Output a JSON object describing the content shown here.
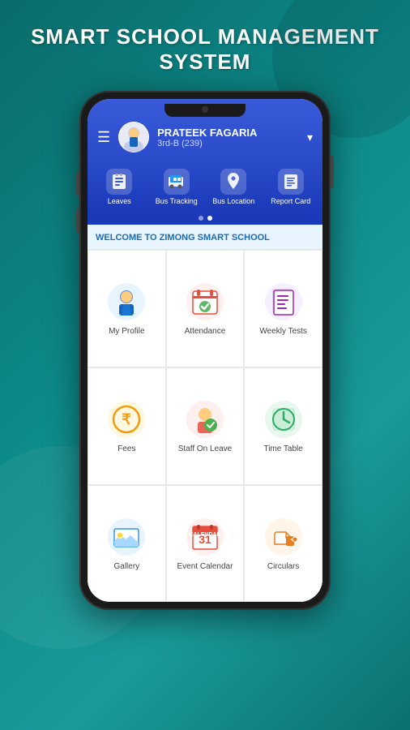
{
  "title": {
    "line1": "SMART SCHOOL MANAGEMENT",
    "line2": "SYSTEM"
  },
  "header": {
    "user_name": "PRATEEK FAGARIA",
    "user_class": "3rd-B (239)",
    "hamburger_label": "☰"
  },
  "nav_icons": [
    {
      "id": "leaves",
      "label": "Leaves",
      "icon": "📋"
    },
    {
      "id": "bus-tracking",
      "label": "Bus Tracking",
      "icon": "🚌"
    },
    {
      "id": "bus-location",
      "label": "Bus Location",
      "icon": "📍"
    },
    {
      "id": "report-card",
      "label": "Report Card",
      "icon": "📄"
    }
  ],
  "dots": [
    {
      "active": false
    },
    {
      "active": true
    }
  ],
  "welcome": "WELCOME TO ZIMONG SMART SCHOOL",
  "menu_items": [
    {
      "id": "my-profile",
      "label": "My Profile",
      "icon": "👨‍💼",
      "color": "#4a90d9"
    },
    {
      "id": "attendance",
      "label": "Attendance",
      "icon": "📅",
      "color": "#e74c3c"
    },
    {
      "id": "weekly-tests",
      "label": "Weekly Tests",
      "icon": "📋",
      "color": "#9b59b6"
    },
    {
      "id": "fees",
      "label": "Fees",
      "icon": "₹",
      "color": "#f39c12"
    },
    {
      "id": "staff-on-leave",
      "label": "Staff On Leave",
      "icon": "👤",
      "color": "#e74c3c"
    },
    {
      "id": "time-table",
      "label": "Time Table",
      "icon": "🗓️",
      "color": "#27ae60"
    },
    {
      "id": "gallery",
      "label": "Gallery",
      "icon": "🖼️",
      "color": "#3498db"
    },
    {
      "id": "event-calendar",
      "label": "Event Calendar",
      "icon": "📆",
      "color": "#e74c3c"
    },
    {
      "id": "circulars",
      "label": "Circulars",
      "icon": "📢",
      "color": "#e67e22"
    }
  ]
}
